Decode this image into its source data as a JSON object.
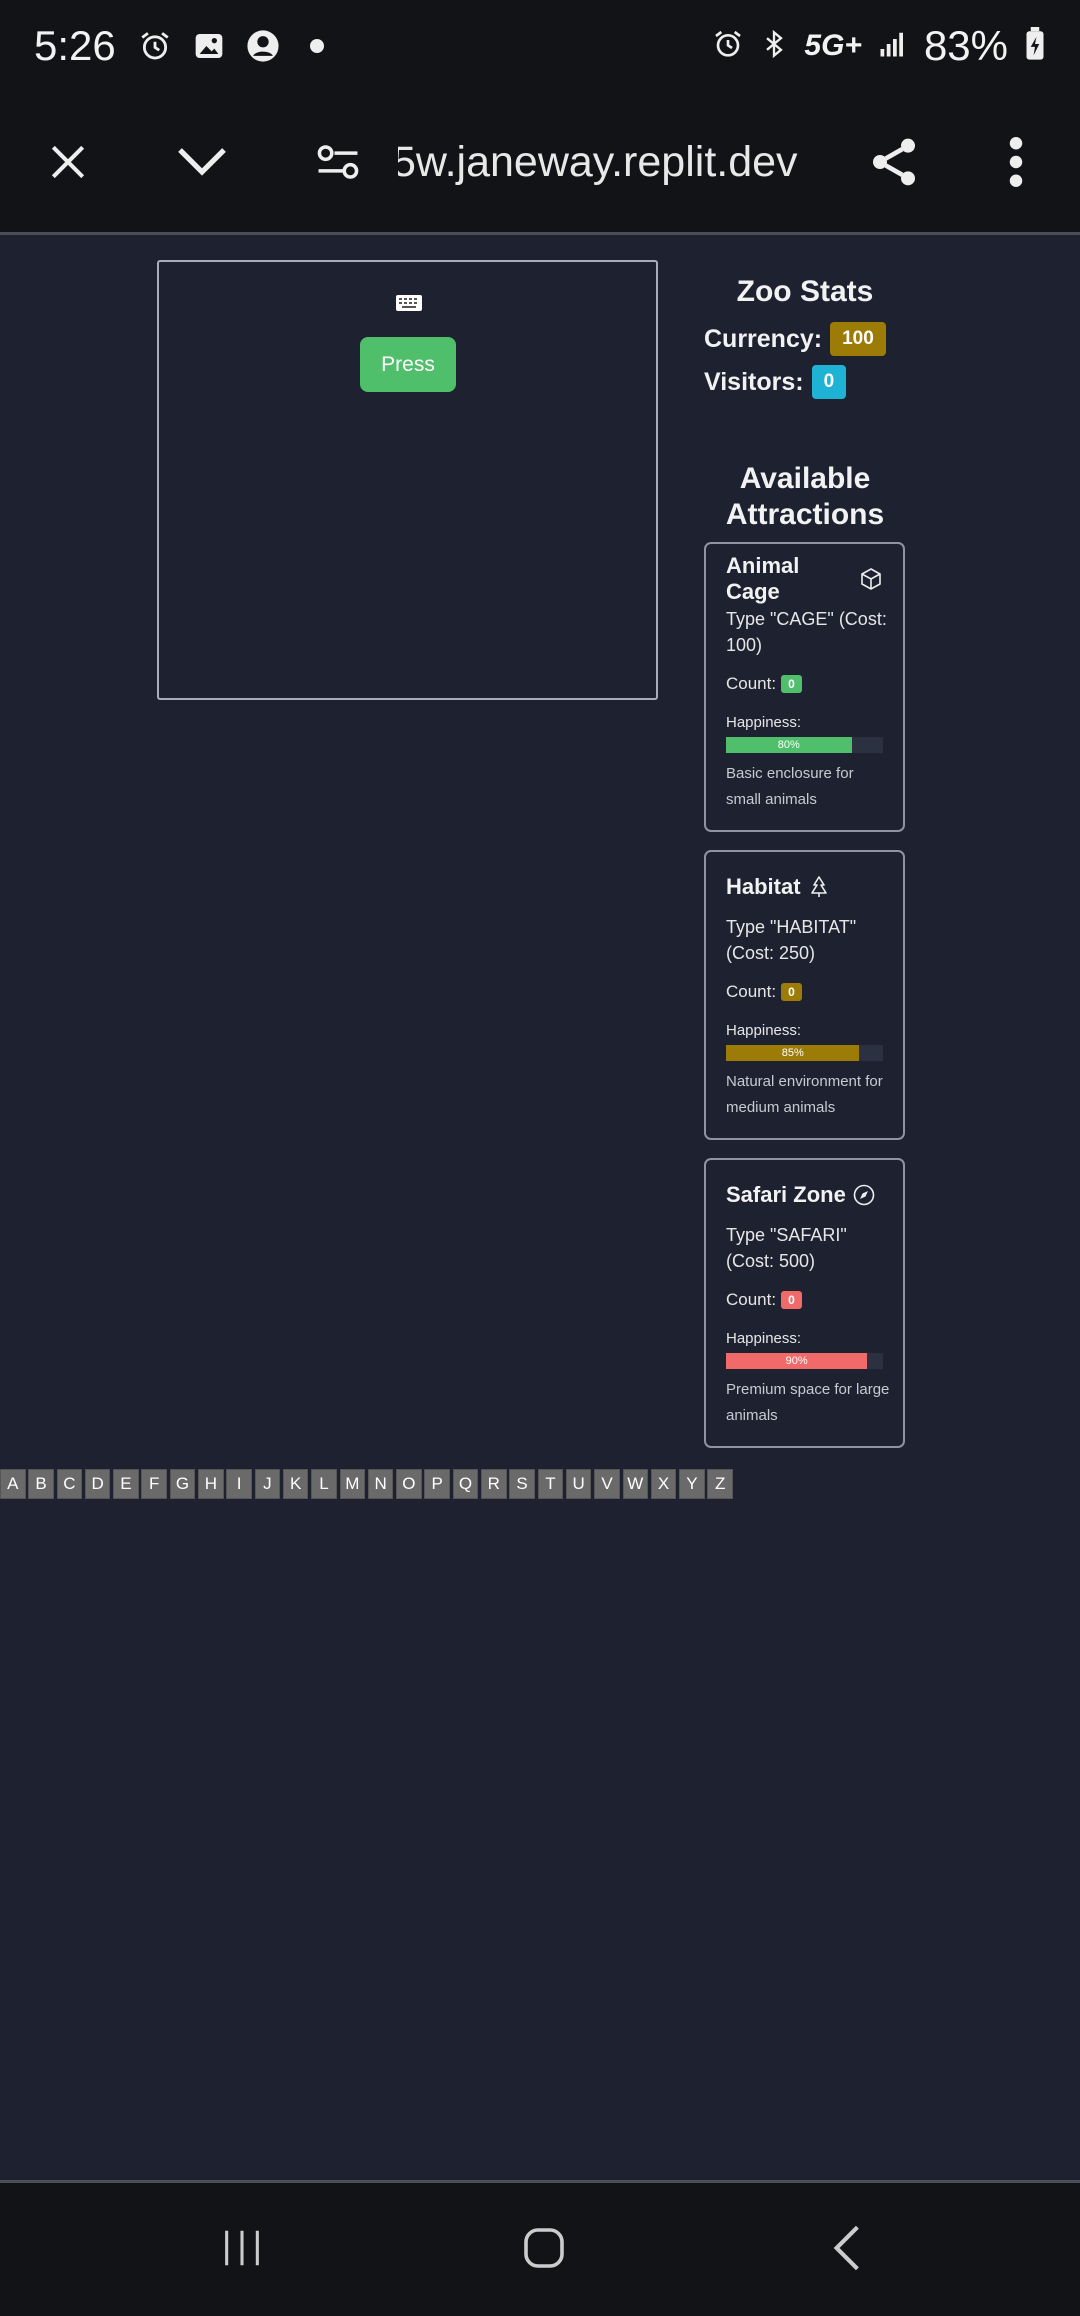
{
  "status_bar": {
    "time": "5:26",
    "network": "5G+",
    "battery": "83%"
  },
  "browser": {
    "url": "5w.janeway.replit.dev"
  },
  "game": {
    "press_label": "Press"
  },
  "zoo_stats": {
    "title": "Zoo Stats",
    "currency_label": "Currency:",
    "currency_value": "100",
    "visitors_label": "Visitors:",
    "visitors_value": "0"
  },
  "attractions": {
    "title": "Available Attractions",
    "count_label": "Count:",
    "happiness_label": "Happiness:",
    "items": [
      {
        "name": "Animal Cage",
        "icon": "cube-icon",
        "type_text": "Type \"CAGE\" (Cost: 100)",
        "count": "0",
        "happiness": 80,
        "happiness_text": "80%",
        "color": "#4fbf6c",
        "description": "Basic enclosure for small animals"
      },
      {
        "name": "Habitat",
        "icon": "tree-icon",
        "type_text": "Type \"HABITAT\" (Cost: 250)",
        "count": "0",
        "happiness": 85,
        "happiness_text": "85%",
        "color": "#9c7b07",
        "description": "Natural environment for medium animals"
      },
      {
        "name": "Safari Zone",
        "icon": "compass-icon",
        "type_text": "Type \"SAFARI\" (Cost: 500)",
        "count": "0",
        "happiness": 90,
        "happiness_text": "90%",
        "color": "#f06a6a",
        "description": "Premium space for large animals"
      }
    ]
  },
  "alphabet": [
    "A",
    "B",
    "C",
    "D",
    "E",
    "F",
    "G",
    "H",
    "I",
    "J",
    "K",
    "L",
    "M",
    "N",
    "O",
    "P",
    "Q",
    "R",
    "S",
    "T",
    "U",
    "V",
    "W",
    "X",
    "Y",
    "Z"
  ]
}
